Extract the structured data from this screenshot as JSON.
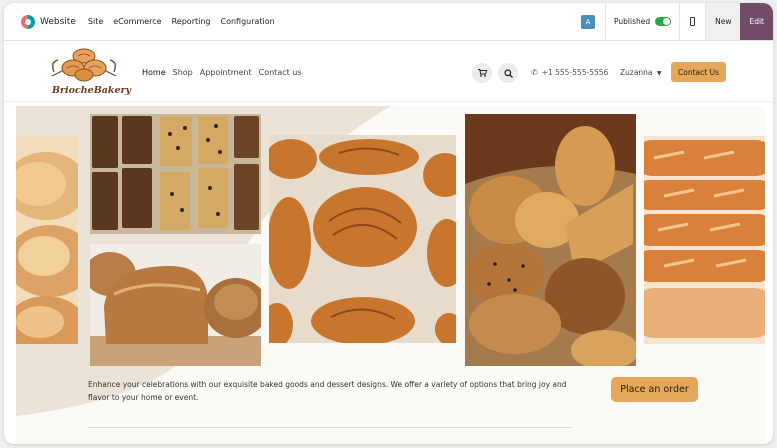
{
  "topbar": {
    "brand": "Website",
    "menu": [
      "Site",
      "eCommerce",
      "Reporting",
      "Configuration"
    ],
    "avatar_letter": "A",
    "published_label": "Published",
    "new_label": "New",
    "edit_label": "Edit"
  },
  "site": {
    "logo_text": "BriocheBakery",
    "nav": [
      "Home",
      "Shop",
      "Appointment",
      "Contact us"
    ],
    "active_nav": "Home",
    "phone": "+1 555-555-5556",
    "user": "Zuzanna",
    "contact_button": "Contact Us"
  },
  "hero": {
    "description": "Enhance your celebrations with our exquisite baked goods and dessert designs. We offer a variety of options that bring joy and flavor to your home or event.",
    "cta": "Place an order",
    "images": [
      "brioche-rolls-photo",
      "loaf-cakes-photo",
      "bread-loaves-photo",
      "croissants-photo",
      "bread-basket-photo",
      "baguettes-photo"
    ]
  },
  "colors": {
    "accent": "#e5a85b",
    "edit": "#714b67",
    "toggle": "#28a745"
  }
}
